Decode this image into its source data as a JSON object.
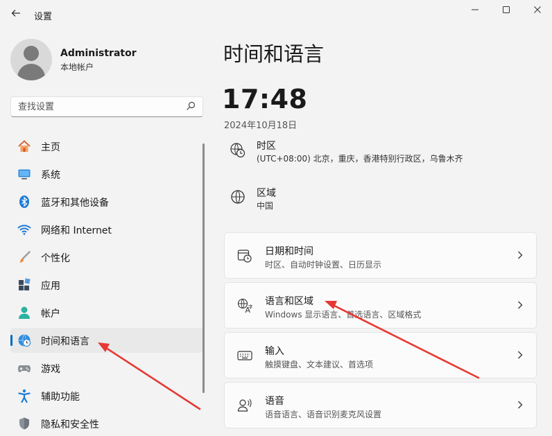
{
  "window": {
    "title": "设置",
    "back_icon": "arrow-left-icon",
    "controls": [
      "minimize-icon",
      "maximize-icon",
      "close-icon"
    ]
  },
  "user": {
    "name": "Administrator",
    "account_type": "本地帐户"
  },
  "search": {
    "placeholder": "查找设置"
  },
  "sidebar": {
    "items": [
      {
        "label": "主页",
        "icon": "home-icon"
      },
      {
        "label": "系统",
        "icon": "monitor-icon"
      },
      {
        "label": "蓝牙和其他设备",
        "icon": "bluetooth-icon"
      },
      {
        "label": "网络和 Internet",
        "icon": "wifi-icon"
      },
      {
        "label": "个性化",
        "icon": "brush-icon"
      },
      {
        "label": "应用",
        "icon": "apps-icon"
      },
      {
        "label": "帐户",
        "icon": "person-icon"
      },
      {
        "label": "时间和语言",
        "icon": "globe-clock-icon",
        "active": true
      },
      {
        "label": "游戏",
        "icon": "gamepad-icon"
      },
      {
        "label": "辅助功能",
        "icon": "accessibility-icon"
      },
      {
        "label": "隐私和安全性",
        "icon": "shield-icon"
      }
    ]
  },
  "main": {
    "title": "时间和语言",
    "time": "17:48",
    "date": "2024年10月18日",
    "timezone": {
      "title": "时区",
      "value": "(UTC+08:00) 北京，重庆，香港特别行政区，乌鲁木齐"
    },
    "region": {
      "title": "区域",
      "value": "中国"
    },
    "cards": [
      {
        "title": "日期和时间",
        "subtitle": "时区、自动时钟设置、日历显示",
        "icon": "calendar-clock-icon"
      },
      {
        "title": "语言和区域",
        "subtitle": "Windows 显示语言、首选语言、区域格式",
        "icon": "language-icon"
      },
      {
        "title": "输入",
        "subtitle": "触摸键盘、文本建议、首选项",
        "icon": "keyboard-icon"
      },
      {
        "title": "语音",
        "subtitle": "语音语言、语音识别麦克风设置",
        "icon": "speech-icon"
      }
    ]
  },
  "colors": {
    "accent": "#0067c0",
    "annotation_arrow": "#e53935",
    "background": "#f3f3f3",
    "card": "#fbfbfb"
  }
}
